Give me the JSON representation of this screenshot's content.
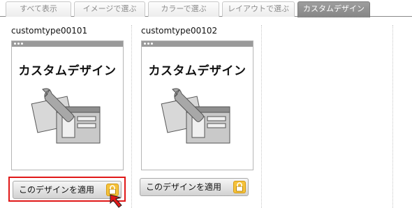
{
  "tabs": [
    {
      "label": "すべて表示",
      "active": false
    },
    {
      "label": "イメージで選ぶ",
      "active": false
    },
    {
      "label": "カラーで選ぶ",
      "active": false
    },
    {
      "label": "レイアウトで選ぶ",
      "active": false
    },
    {
      "label": "カスタムデザイン",
      "active": true
    }
  ],
  "cards": [
    {
      "name": "customtype00101",
      "thumb_text": "カスタムデザイン",
      "apply_label": "このデザインを適用",
      "highlighted": true
    },
    {
      "name": "customtype00102",
      "thumb_text": "カスタムデザイン",
      "apply_label": "このデザインを適用",
      "highlighted": false
    }
  ],
  "colors": {
    "highlight": "#e01818",
    "lock": "#f5c23a",
    "active_tab": "#8f8f8f"
  },
  "icons": [
    "wrench-icon",
    "lock-icon",
    "arrow-pointer-icon"
  ]
}
